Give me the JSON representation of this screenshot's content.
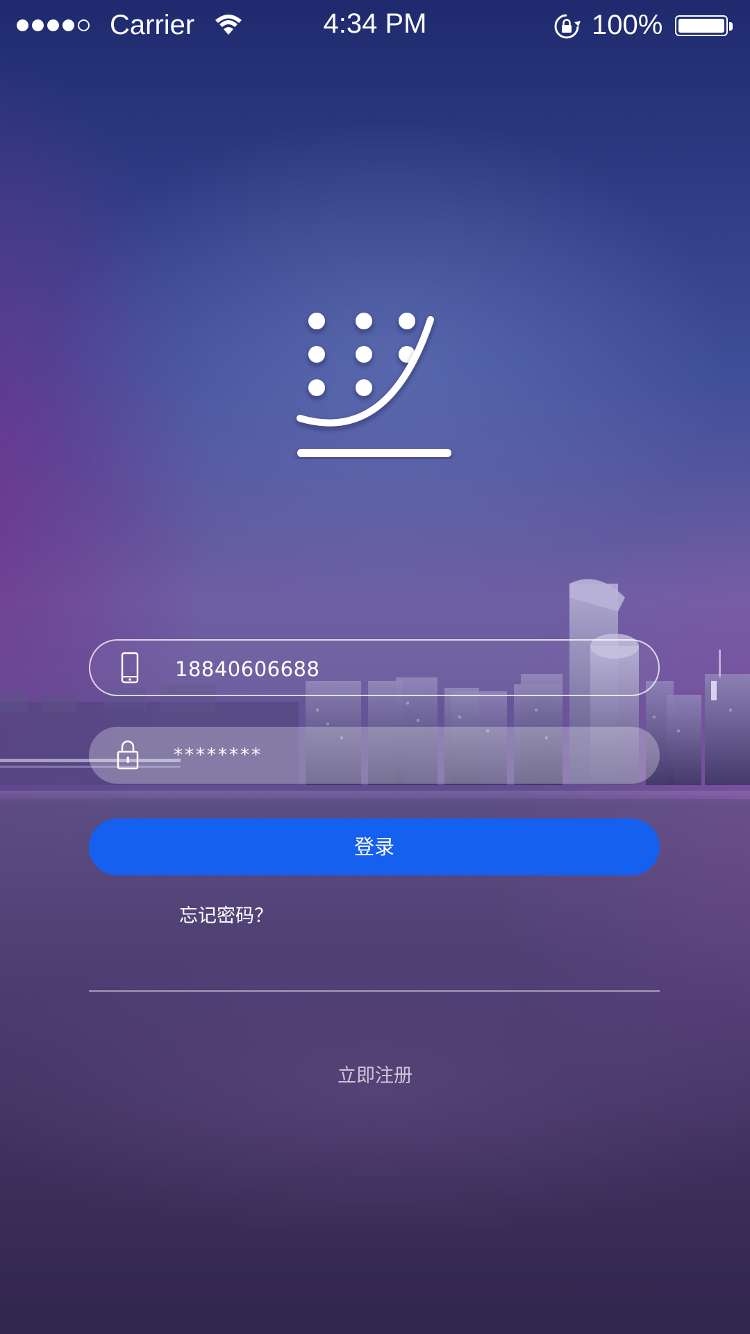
{
  "status_bar": {
    "carrier": "Carrier",
    "time": "4:34 PM",
    "battery_percent": "100%",
    "signal_bars_filled": 4,
    "signal_bars_total": 5,
    "battery_level": 1.0
  },
  "logo": {
    "icon": "dots-curve-logo-icon"
  },
  "login_form": {
    "phone": {
      "icon": "phone-icon",
      "value": "18840606688"
    },
    "password": {
      "icon": "lock-icon",
      "value": "********"
    },
    "login_button_label": "登录",
    "forgot_password_label": "忘记密码？",
    "register_label": "立即注册"
  },
  "colors": {
    "accent": "#1560ee",
    "text": "#ffffff"
  }
}
